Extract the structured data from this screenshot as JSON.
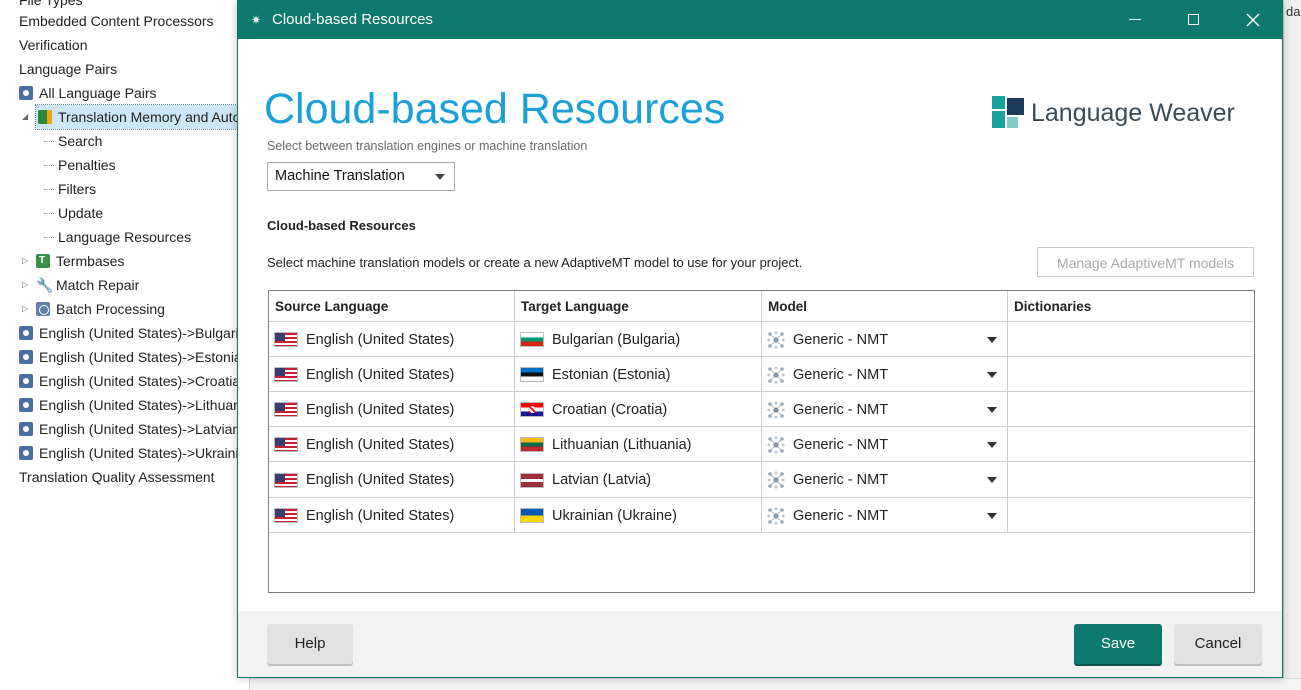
{
  "background_tree": {
    "items": [
      {
        "label": "File Types",
        "indent": 19,
        "icon": ""
      },
      {
        "label": "Embedded Content Processors",
        "indent": 19,
        "icon": ""
      },
      {
        "label": "Verification",
        "indent": 19,
        "icon": ""
      },
      {
        "label": "Language Pairs",
        "indent": 19,
        "icon": ""
      },
      {
        "label": "All Language Pairs",
        "indent": 19,
        "icon": "globe-icon"
      },
      {
        "label": "Translation Memory and Automated Translation",
        "indent": 24,
        "icon": "tm-icon",
        "expander": "◢",
        "selected": true
      },
      {
        "label": "Search",
        "indent": 44,
        "icon": "",
        "leaf": true
      },
      {
        "label": "Penalties",
        "indent": 44,
        "icon": "",
        "leaf": true
      },
      {
        "label": "Filters",
        "indent": 44,
        "icon": "",
        "leaf": true
      },
      {
        "label": "Update",
        "indent": 44,
        "icon": "",
        "leaf": true
      },
      {
        "label": "Language Resources",
        "indent": 44,
        "icon": "",
        "leaf": true
      },
      {
        "label": "Termbases",
        "indent": 24,
        "icon": "termbase-icon",
        "expander": "▷"
      },
      {
        "label": "Match Repair",
        "indent": 24,
        "icon": "wrench-icon",
        "expander": "▷"
      },
      {
        "label": "Batch Processing",
        "indent": 24,
        "icon": "batch-icon",
        "expander": "▷"
      },
      {
        "label": "English (United States)->Bulgarian",
        "indent": 19,
        "icon": "globe-icon"
      },
      {
        "label": "English (United States)->Estonian",
        "indent": 19,
        "icon": "globe-icon"
      },
      {
        "label": "English (United States)->Croatian",
        "indent": 19,
        "icon": "globe-icon"
      },
      {
        "label": "English (United States)->Lithuanian",
        "indent": 19,
        "icon": "globe-icon"
      },
      {
        "label": "English (United States)->Latvian",
        "indent": 19,
        "icon": "globe-icon"
      },
      {
        "label": "English (United States)->Ukrainian",
        "indent": 19,
        "icon": "globe-icon"
      },
      {
        "label": "Translation Quality Assessment",
        "indent": 19,
        "icon": ""
      }
    ],
    "right_edge_text": "da"
  },
  "dialog": {
    "title": "Cloud-based Resources",
    "heading": "Cloud-based Resources",
    "subheading": "Select between translation engines or machine translation",
    "logo_text": "Language Weaver",
    "mode_select": "Machine Translation",
    "section_title": "Cloud-based Resources",
    "section_desc": "Select machine translation models or create a new AdaptiveMT model to use for your project.",
    "manage_button": "Manage AdaptiveMT models",
    "grid": {
      "columns": [
        "Source Language",
        "Target Language",
        "Model",
        "Dictionaries"
      ],
      "rows": [
        {
          "source": "English (United States)",
          "source_flag": "us-flag-icon",
          "target": "Bulgarian (Bulgaria)",
          "target_flag": "bulgaria-flag-icon",
          "model": "Generic - NMT",
          "dictionaries": ""
        },
        {
          "source": "English (United States)",
          "source_flag": "us-flag-icon",
          "target": "Estonian (Estonia)",
          "target_flag": "estonia-flag-icon",
          "model": "Generic - NMT",
          "dictionaries": ""
        },
        {
          "source": "English (United States)",
          "source_flag": "us-flag-icon",
          "target": "Croatian (Croatia)",
          "target_flag": "croatia-flag-icon",
          "model": "Generic - NMT",
          "dictionaries": ""
        },
        {
          "source": "English (United States)",
          "source_flag": "us-flag-icon",
          "target": "Lithuanian (Lithuania)",
          "target_flag": "lithuania-flag-icon",
          "model": "Generic - NMT",
          "dictionaries": ""
        },
        {
          "source": "English (United States)",
          "source_flag": "us-flag-icon",
          "target": "Latvian (Latvia)",
          "target_flag": "latvia-flag-icon",
          "model": "Generic - NMT",
          "dictionaries": ""
        },
        {
          "source": "English (United States)",
          "source_flag": "us-flag-icon",
          "target": "Ukrainian (Ukraine)",
          "target_flag": "ukraine-flag-icon",
          "model": "Generic - NMT",
          "dictionaries": ""
        }
      ]
    },
    "footer": {
      "help": "Help",
      "save": "Save",
      "cancel": "Cancel"
    }
  },
  "colors": {
    "accent": "#0e7a6e",
    "heading": "#1a9fd9",
    "logo_dark": "#1b3a57",
    "logo_teal": "#1aa39a"
  }
}
